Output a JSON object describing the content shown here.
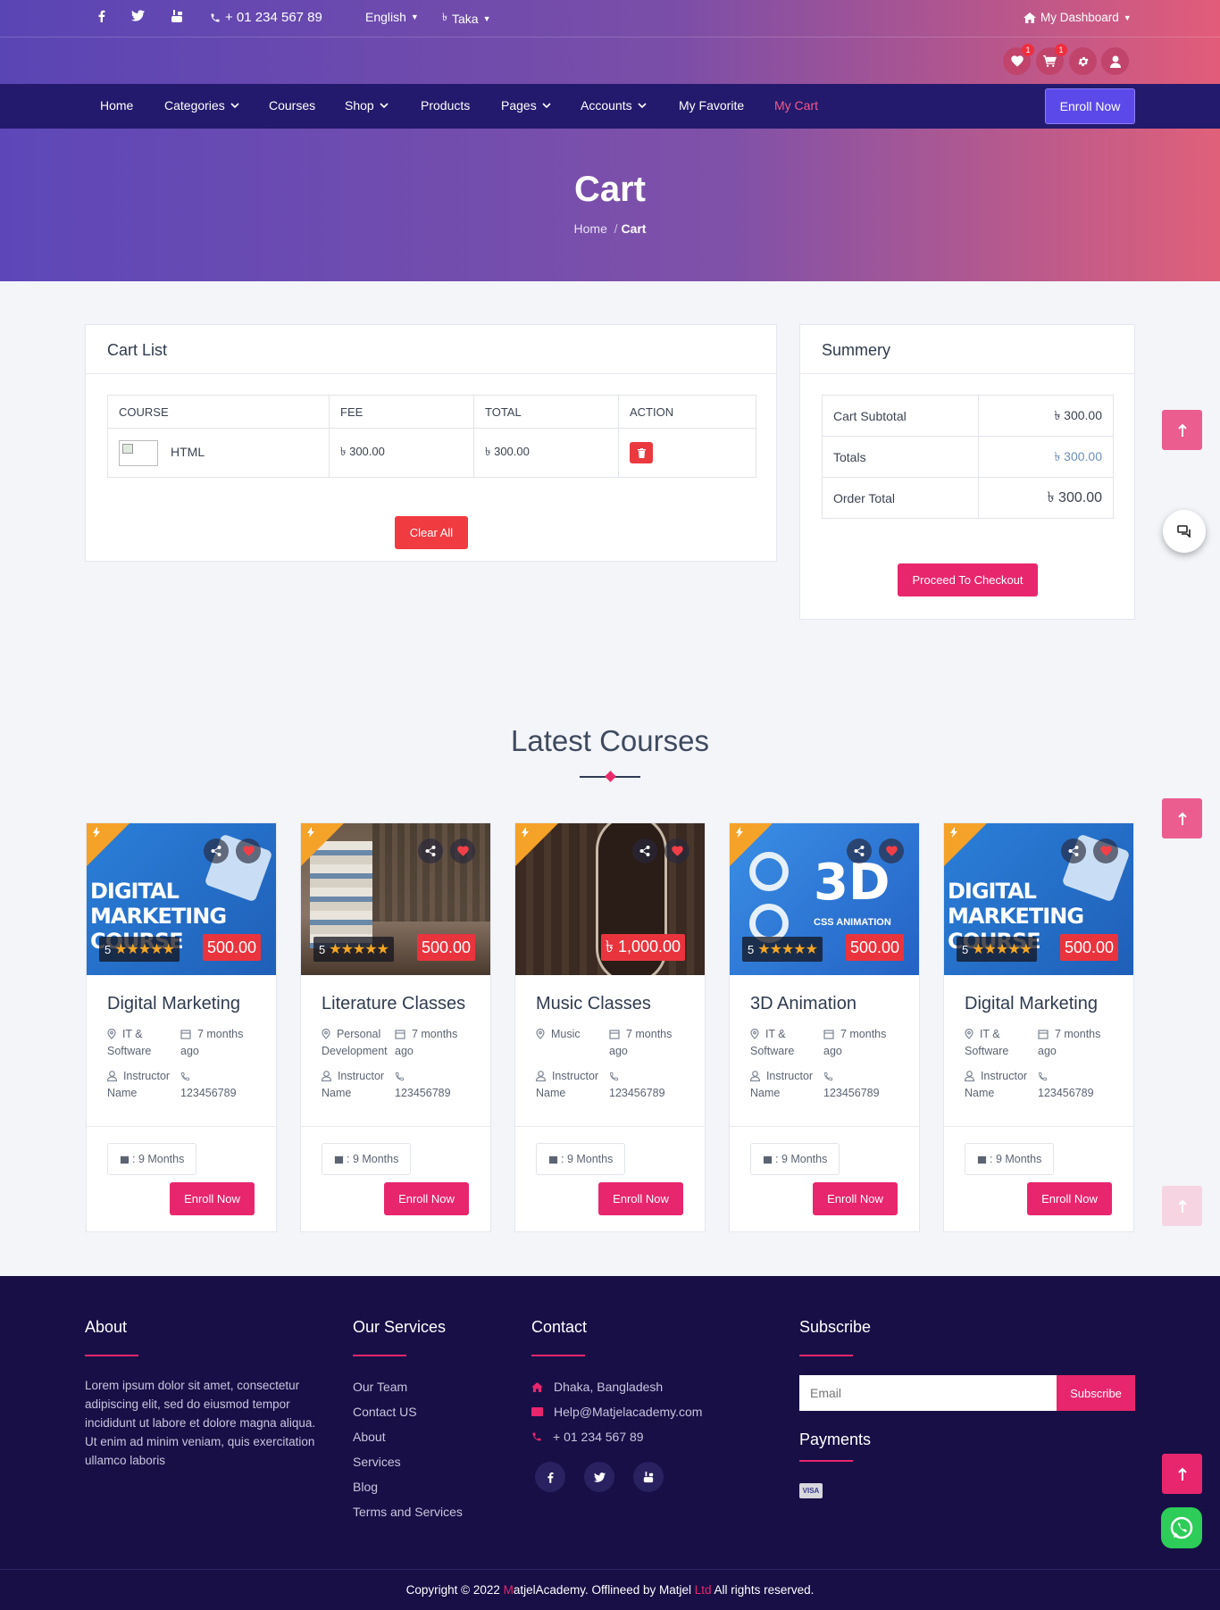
{
  "topbar": {
    "phone": "+ 01 234 567 89",
    "language": "English",
    "currency": "Taka",
    "dashboard": "My Dashboard",
    "wishlist_count": "1",
    "cart_count": "1"
  },
  "nav": {
    "items": [
      "Home",
      "Categories",
      "Courses",
      "Shop",
      "Products",
      "Pages",
      "Accounts",
      "My Favorite",
      "My Cart"
    ],
    "enroll": "Enroll Now"
  },
  "hero": {
    "title": "Cart",
    "crumb_home": "Home",
    "crumb_sep": "/",
    "crumb_current": "Cart"
  },
  "cart": {
    "title": "Cart List",
    "headers": [
      "COURSE",
      "FEE",
      "TOTAL",
      "ACTION"
    ],
    "rows": [
      {
        "course": "HTML",
        "fee": "৳ 300.00",
        "total": "৳ 300.00"
      }
    ],
    "clear": "Clear All"
  },
  "summary": {
    "title": "Summery",
    "subtotal_label": "Cart Subtotal",
    "subtotal": "৳ 300.00",
    "totals_label": "Totals",
    "totals": "৳ 300.00",
    "order_label": "Order Total",
    "order_total": "৳ 300.00",
    "checkout": "Proceed To Checkout"
  },
  "latest": {
    "title": "Latest Courses",
    "courses": [
      {
        "name": "Digital Marketing",
        "category": "IT & Software",
        "time": "7 months ago",
        "instructor": "Instructor Name",
        "phone": "123456789",
        "rating": "5",
        "price": "500.00",
        "duration": ": 9 Months",
        "enroll": "Enroll Now"
      },
      {
        "name": "Literature Classes",
        "category": "Personal Development",
        "time": "7 months ago",
        "instructor": "Instructor Name",
        "phone": "123456789",
        "rating": "5",
        "price": "500.00",
        "duration": ": 9 Months",
        "enroll": "Enroll Now"
      },
      {
        "name": "Music Classes",
        "category": "Music",
        "time": "7 months ago",
        "instructor": "Instructor Name",
        "phone": "123456789",
        "rating": "",
        "price": "৳ 1,000.00",
        "duration": ": 9 Months",
        "enroll": "Enroll Now"
      },
      {
        "name": "3D Animation",
        "category": "IT & Software",
        "time": "7 months ago",
        "instructor": "Instructor Name",
        "phone": "123456789",
        "rating": "5",
        "price": "500.00",
        "duration": ": 9 Months",
        "enroll": "Enroll Now"
      },
      {
        "name": "Digital Marketing",
        "category": "IT & Software",
        "time": "7 months ago",
        "instructor": "Instructor Name",
        "phone": "123456789",
        "rating": "5",
        "price": "500.00",
        "duration": ": 9 Months",
        "enroll": "Enroll Now"
      }
    ],
    "image_text": {
      "dm_line1": "DIGITAL",
      "dm_line2": "MARKETING",
      "dm_line3": "COURSE",
      "anim_big": "3D",
      "anim_small": "CSS ANIMATION"
    }
  },
  "footer": {
    "about_title": "About",
    "about_text": "Lorem ipsum dolor sit amet, consectetur adipiscing elit, sed do eiusmod tempor incididunt ut labore et dolore magna aliqua. Ut enim ad minim veniam, quis exercitation ullamco laboris",
    "services_title": "Our Services",
    "services": [
      "Our Team",
      "Contact US",
      "About",
      "Services",
      "Blog",
      "Terms and Services"
    ],
    "contact_title": "Contact",
    "address": "Dhaka, Bangladesh",
    "email": "Help@Matjelacademy.com",
    "phone": "+ 01 234 567 89",
    "subscribe_title": "Subscribe",
    "email_placeholder": "Email",
    "subscribe_btn": "Subscribe",
    "payments_title": "Payments",
    "visa": "VISA",
    "copy_pre": "Copyright © 2022 ",
    "copy_m": "M",
    "copy_mid": "atjelAcademy. Offlineed by Matjel ",
    "copy_ltd": "Ltd",
    "copy_end": " All rights reserved."
  },
  "colors": {
    "accent": "#e8266d",
    "nav": "#241a6d",
    "footer": "#170f46",
    "enroll": "#5b49ea",
    "danger": "#f03b41"
  }
}
